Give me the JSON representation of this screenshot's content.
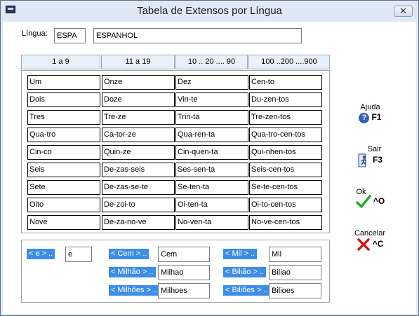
{
  "window": {
    "title": "Tabela de Extensos por Língua",
    "close_glyph": "✕"
  },
  "lingua": {
    "label": "Língua:",
    "code": "ESPA",
    "name": "ESPANHOL"
  },
  "tabs": [
    {
      "label": "1 a 9"
    },
    {
      "label": "11 a 19"
    },
    {
      "label": "10 .. 20 .... 90"
    },
    {
      "label": "100 ..200 ....900"
    }
  ],
  "grid": {
    "columns": [
      [
        "Um",
        "Dois",
        "Tres",
        "Qua-tro",
        "Cin-co",
        "Seis",
        "Sete",
        "Oito",
        "Nove"
      ],
      [
        "Onze",
        "Doze",
        "Tre-ze",
        "Ca-tor-ze",
        "Quin-ze",
        "De-zas-seis",
        "De-zas-se-te",
        "De-zoi-to",
        "De-za-no-ve"
      ],
      [
        "Dez",
        "Vin-te",
        "Trin-ta",
        "Qua-ren-ta",
        "Cin-quen-ta",
        "Ses-sen-ta",
        "Se-ten-ta",
        "Oi-ten-ta",
        "No-ven-ta"
      ],
      [
        "Cen-to",
        "Du-zen-tos",
        "Tre-zen-tos",
        "Qua-tro-cen-tos",
        "Qui-nhen-tos",
        "Seis-cen-tos",
        "Se-te-cen-tos",
        "Oi-to-cen-tos",
        "No-ve-cen-tos"
      ]
    ]
  },
  "actions": {
    "ajuda": {
      "label": "Ajuda",
      "key": "F1",
      "icon": "help-icon"
    },
    "sair": {
      "label": "Sair",
      "key": "F3",
      "icon": "exit-door-icon"
    },
    "ok": {
      "label": "Ok",
      "key": "^O",
      "icon": "checkmark-icon",
      "color": "#2aa52a"
    },
    "cancelar": {
      "label": "Cancelar",
      "key": "^C",
      "icon": "red-x-icon",
      "color": "#d01818"
    }
  },
  "connectors": {
    "e": {
      "label": "< e > ..",
      "value": "e"
    },
    "cem": {
      "label": "< Cem > ..",
      "value": "Cem"
    },
    "milhao": {
      "label": "< Milhão > ..",
      "value": "Milhao"
    },
    "milhoes": {
      "label": "< Milhões > ..",
      "value": "Milhoes"
    },
    "mil": {
      "label": "< Mil > ..",
      "value": "Mil"
    },
    "biliao": {
      "label": "< Bilião > ..",
      "value": "Biliao"
    },
    "bilioes": {
      "label": "< Biliões > ..",
      "value": "Bilioes"
    }
  },
  "colors": {
    "accent": "#3d8ee6",
    "window_bg": "#dfeaf6"
  }
}
